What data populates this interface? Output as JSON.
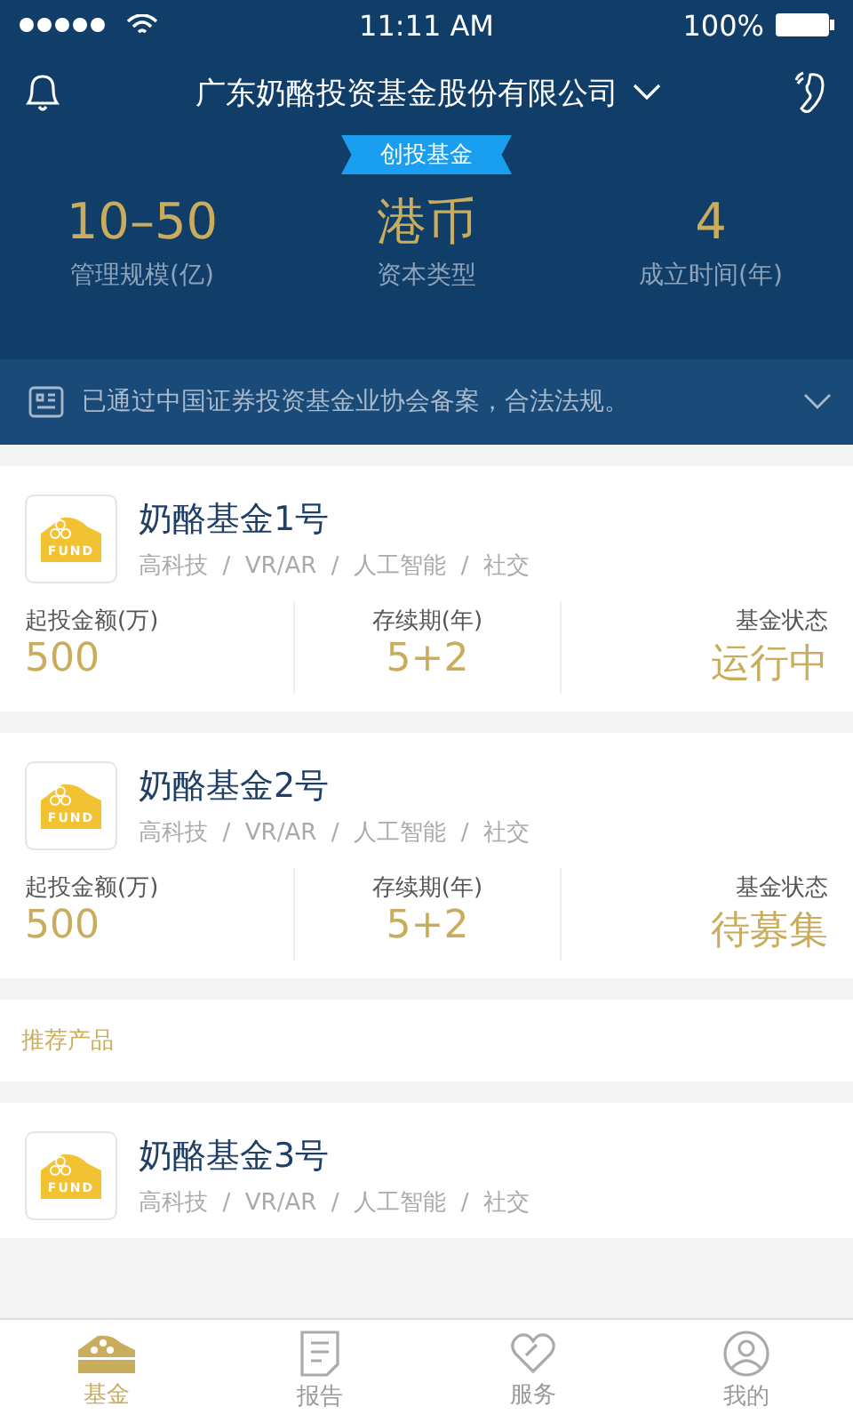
{
  "status_bar": {
    "time": "11:11 AM",
    "battery": "100%"
  },
  "header": {
    "company": "广东奶酪投资基金股份有限公司",
    "badge": "创投基金",
    "stats": [
      {
        "value": "10–50",
        "label": "管理规模(亿)"
      },
      {
        "value": "港币",
        "label": "资本类型"
      },
      {
        "value": "4",
        "label": "成立时间(年)"
      }
    ]
  },
  "notice": {
    "text": "已通过中国证券投资基金业协会备案，合法法规。"
  },
  "funds": [
    {
      "logo_text": "FUND",
      "name": "奶酪基金1号",
      "tags": "高科技  /  VR/AR  /  人工智能  /  社交",
      "stats": [
        {
          "label": "起投金额(万)",
          "value": "500"
        },
        {
          "label": "存续期(年)",
          "value": "5+2"
        },
        {
          "label": "基金状态",
          "value": "运行中"
        }
      ]
    },
    {
      "logo_text": "FUND",
      "name": "奶酪基金2号",
      "tags": "高科技  /  VR/AR  /  人工智能  /  社交",
      "stats": [
        {
          "label": "起投金额(万)",
          "value": "500"
        },
        {
          "label": "存续期(年)",
          "value": "5+2"
        },
        {
          "label": "基金状态",
          "value": "待募集"
        }
      ]
    }
  ],
  "recommended": {
    "title": "推荐产品",
    "funds": [
      {
        "logo_text": "FUND",
        "name": "奶酪基金3号",
        "tags": "高科技  /  VR/AR  /  人工智能  /  社交"
      }
    ]
  },
  "tab_bar": [
    {
      "kind": "fund",
      "label": "基金",
      "selected": true
    },
    {
      "kind": "report",
      "label": "报告",
      "selected": false
    },
    {
      "kind": "service",
      "label": "服务",
      "selected": false
    },
    {
      "kind": "me",
      "label": "我的",
      "selected": false
    }
  ]
}
